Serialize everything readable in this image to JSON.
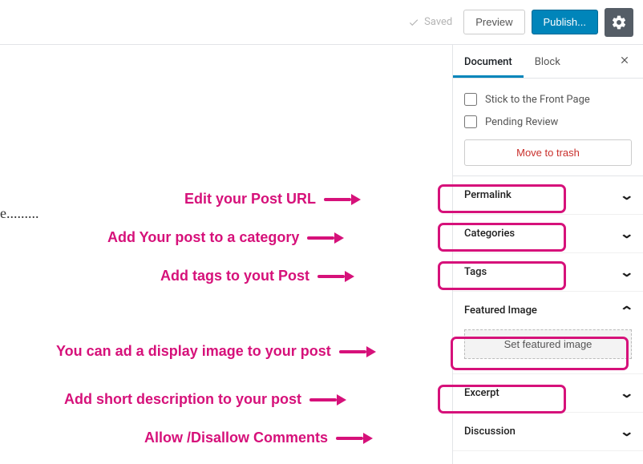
{
  "topbar": {
    "saved_label": "Saved",
    "preview_label": "Preview",
    "publish_label": "Publish..."
  },
  "tabs": {
    "document": "Document",
    "block": "Block"
  },
  "status": {
    "stick_front": "Stick to the Front Page",
    "pending": "Pending Review",
    "trash": "Move to trash"
  },
  "panels": {
    "permalink": "Permalink",
    "categories": "Categories",
    "tags": "Tags",
    "featured_image": "Featured Image",
    "set_featured": "Set featured image",
    "excerpt": "Excerpt",
    "discussion": "Discussion"
  },
  "side_text": "e.........",
  "annotations": {
    "permalink": "Edit your Post URL",
    "categories": "Add Your post to a category",
    "tags": "Add  tags to yout Post",
    "featured": "You can ad  a display image to your post",
    "excerpt": "Add short description to your post",
    "discussion": "Allow /Disallow  Comments"
  }
}
